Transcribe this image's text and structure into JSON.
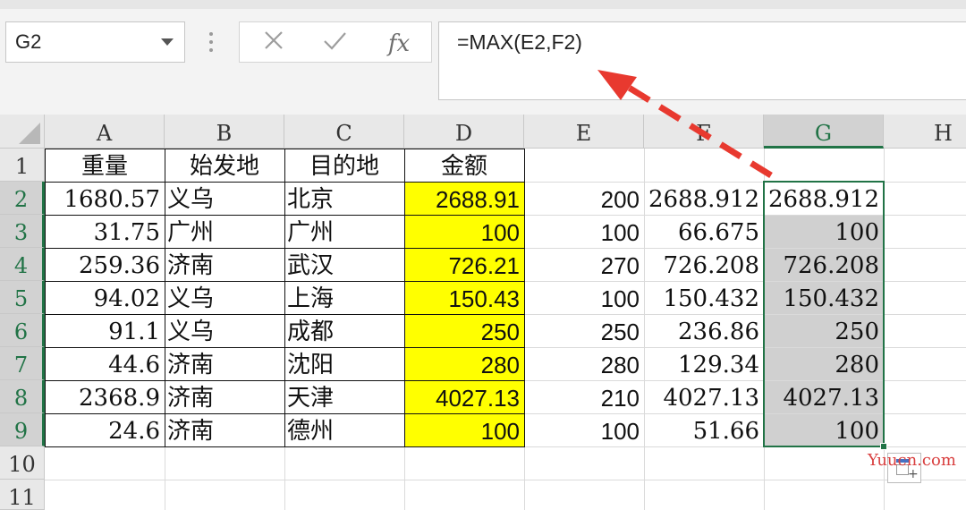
{
  "formula_bar": {
    "name_box": "G2",
    "cancel_icon": "cancel-x-icon",
    "enter_icon": "check-icon",
    "fx_label": "fx",
    "formula": "=MAX(E2,F2)"
  },
  "columns": [
    "A",
    "B",
    "C",
    "D",
    "E",
    "F",
    "G",
    "H"
  ],
  "rows": [
    "1",
    "2",
    "3",
    "4",
    "5",
    "6",
    "7",
    "8",
    "9",
    "10",
    "11"
  ],
  "headers": {
    "a": "重量",
    "b": "始发地",
    "c": "目的地",
    "d": "金额"
  },
  "data": [
    {
      "a": "1680.57",
      "b": "义乌",
      "c": "北京",
      "d": "2688.91",
      "e": "200",
      "f": "2688.912",
      "g": "2688.912"
    },
    {
      "a": "31.75",
      "b": "广州",
      "c": "广州",
      "d": "100",
      "e": "100",
      "f": "66.675",
      "g": "100"
    },
    {
      "a": "259.36",
      "b": "济南",
      "c": "武汉",
      "d": "726.21",
      "e": "270",
      "f": "726.208",
      "g": "726.208"
    },
    {
      "a": "94.02",
      "b": "义乌",
      "c": "上海",
      "d": "150.43",
      "e": "100",
      "f": "150.432",
      "g": "150.432"
    },
    {
      "a": "91.1",
      "b": "义乌",
      "c": "成都",
      "d": "250",
      "e": "250",
      "f": "236.86",
      "g": "250"
    },
    {
      "a": "44.6",
      "b": "济南",
      "c": "沈阳",
      "d": "280",
      "e": "280",
      "f": "129.34",
      "g": "280"
    },
    {
      "a": "2368.9",
      "b": "济南",
      "c": "天津",
      "d": "4027.13",
      "e": "210",
      "f": "4027.13",
      "g": "4027.13"
    },
    {
      "a": "24.6",
      "b": "济南",
      "c": "德州",
      "d": "100",
      "e": "100",
      "f": "51.66",
      "g": "100"
    }
  ],
  "selection": {
    "active_cell": "G2",
    "range": "G2:G9"
  },
  "colors": {
    "highlight_yellow": "#ffff00",
    "selection_grey": "#d0d0d0",
    "selection_green": "#217346",
    "arrow_red": "#e8392f"
  },
  "watermark": "Yuucn.com"
}
